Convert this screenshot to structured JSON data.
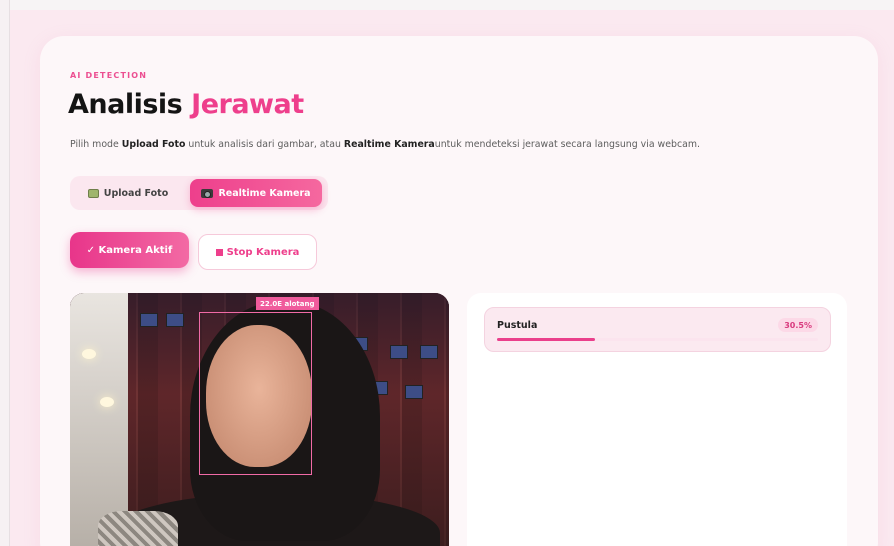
{
  "header": {
    "eyebrow": "AI DETECTION",
    "title_main": "Analisis",
    "title_accent": "Jerawat",
    "desc_1": "Pilih mode ",
    "desc_upload": "Upload Foto",
    "desc_2": " untuk analisis dari gambar, atau ",
    "desc_realtime": "Realtime Kamera",
    "desc_3": "untuk mendeteksi jerawat secara langsung via webcam."
  },
  "modes": {
    "upload_label": "Upload Foto",
    "realtime_label": "Realtime Kamera",
    "selected": "Realtime Kamera",
    "upload_icon": "photo-icon",
    "realtime_icon": "camera-icon"
  },
  "camera": {
    "active_label": "✓ Kamera Aktif",
    "stop_label": "Stop Kamera"
  },
  "detection": {
    "box_label": "22.0E alotang"
  },
  "results": {
    "items": [
      {
        "label": "Pustula",
        "percent_text": "30.5%",
        "fraction": 0.305
      }
    ]
  },
  "colors": {
    "accent": "#ee3f8c",
    "background": "#fbe9f0"
  }
}
